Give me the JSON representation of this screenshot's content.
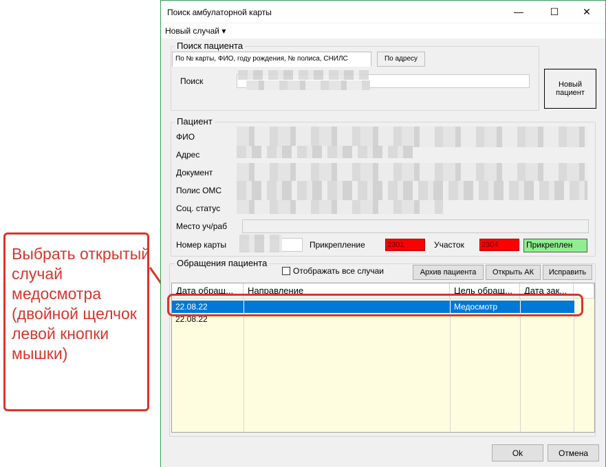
{
  "window": {
    "title": "Поиск амбулаторной карты",
    "controls": {
      "minimize": "—",
      "maximize": "☐",
      "close": "✕"
    }
  },
  "menu": {
    "new_case": "Новый случай ▾"
  },
  "search": {
    "group_title": "Поиск пациента",
    "tab_main": "По № карты, ФИО, году рождения, № полиса, СНИЛС",
    "tab_address": "По адресу",
    "label": "Поиск",
    "new_patient_button": "Новый пациент"
  },
  "patient": {
    "group_title": "Пациент",
    "fio_label": "ФИО",
    "address_label": "Адрес",
    "document_label": "Документ",
    "oms_label": "Полис ОМС",
    "social_label": "Соц. статус",
    "workplace_label": "Место уч/раб",
    "card_number_label": "Номер карты",
    "attachment_label": "Прикрепление",
    "attachment_value": "2301",
    "district_label": "Участок",
    "district_value": "2304",
    "status_value": "Прикреплен"
  },
  "visits": {
    "group_title": "Обращения пациента",
    "show_all_label": "Отображать все случаи",
    "archive_button": "Архив пациента",
    "open_ak_button": "Открыть АК",
    "edit_button": "Исправить",
    "columns": [
      "Дата обращ...",
      "Направление",
      "Цель обращ...",
      "Дата зак..."
    ],
    "rows": [
      {
        "date": "22.08.22",
        "direction": "",
        "purpose": "Медосмотр",
        "closed": ""
      },
      {
        "date": "22.08.22",
        "direction": "",
        "purpose": "",
        "closed": ""
      }
    ]
  },
  "footer": {
    "ok_button": "Ok",
    "cancel_button": "Отмена"
  },
  "annotation": {
    "text": "Выбрать открытый случай медосмотра (двойной щелчок левой кнопки мышки)"
  },
  "colors": {
    "selection": "#0078d7",
    "annotation": "#d9342b",
    "grid_bg": "#fffde0",
    "alert_red": "#ff0000",
    "status_green": "#90ee90"
  }
}
